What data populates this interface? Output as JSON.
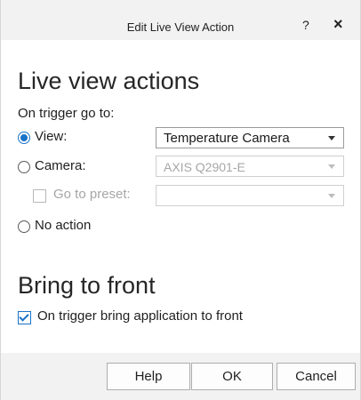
{
  "window": {
    "title": "Edit Live View Action",
    "help_glyph": "?",
    "close_glyph": "×",
    "icons": {
      "help": "question-mark-icon",
      "close": "close-icon"
    }
  },
  "live_view": {
    "heading": "Live view actions",
    "trigger_label": "On trigger go to:",
    "view": {
      "label": "View:",
      "selected": true,
      "value": "Temperature Camera",
      "enabled": true
    },
    "camera": {
      "label": "Camera:",
      "selected": false,
      "value": "AXIS Q2901-E",
      "enabled": false
    },
    "preset": {
      "label": "Go to preset:",
      "checked": false,
      "value": "",
      "enabled": false
    },
    "no_action": {
      "label": "No action",
      "selected": false
    }
  },
  "bring_to_front": {
    "heading": "Bring to front",
    "checkbox_label": "On trigger bring application to front",
    "checked": true
  },
  "footer": {
    "help_label": "Help",
    "ok_label": "OK",
    "cancel_label": "Cancel"
  },
  "colors": {
    "accent": "#1a73c8",
    "disabled_text": "#a6a6a6",
    "titlebar_bg": "#f2f2f2"
  }
}
